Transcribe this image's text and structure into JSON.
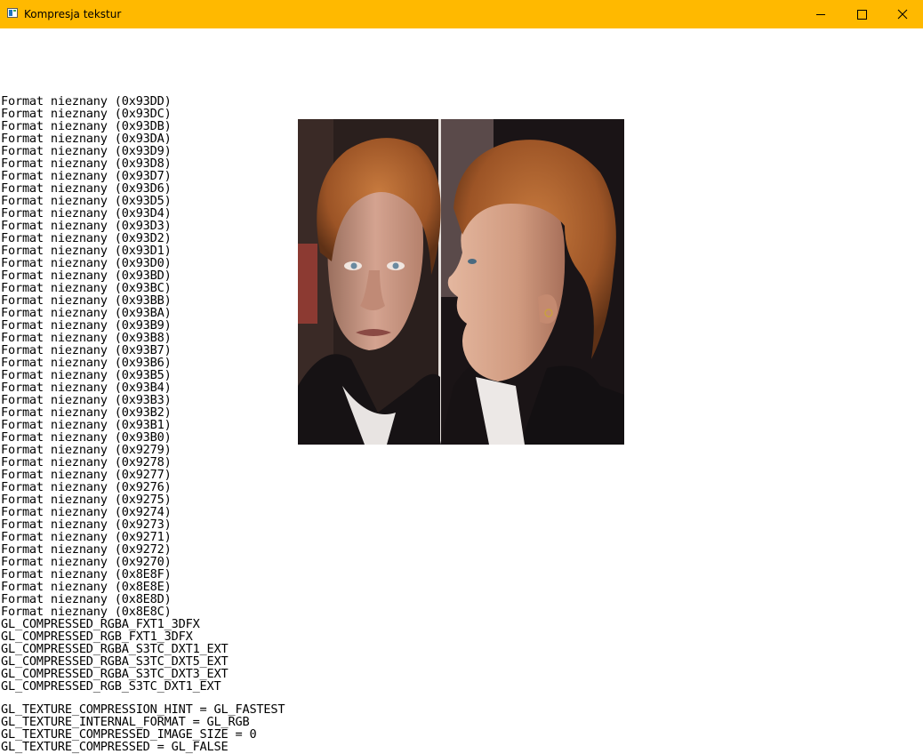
{
  "window": {
    "title": "Kompresja tekstur",
    "accent_color": "#ffb900",
    "icons": [
      "app-icon",
      "minimize-icon",
      "maximize-icon",
      "close-icon"
    ]
  },
  "formats": [
    "Format nieznany (0x93DD)",
    "Format nieznany (0x93DC)",
    "Format nieznany (0x93DB)",
    "Format nieznany (0x93DA)",
    "Format nieznany (0x93D9)",
    "Format nieznany (0x93D8)",
    "Format nieznany (0x93D7)",
    "Format nieznany (0x93D6)",
    "Format nieznany (0x93D5)",
    "Format nieznany (0x93D4)",
    "Format nieznany (0x93D3)",
    "Format nieznany (0x93D2)",
    "Format nieznany (0x93D1)",
    "Format nieznany (0x93D0)",
    "Format nieznany (0x93BD)",
    "Format nieznany (0x93BC)",
    "Format nieznany (0x93BB)",
    "Format nieznany (0x93BA)",
    "Format nieznany (0x93B9)",
    "Format nieznany (0x93B8)",
    "Format nieznany (0x93B7)",
    "Format nieznany (0x93B6)",
    "Format nieznany (0x93B5)",
    "Format nieznany (0x93B4)",
    "Format nieznany (0x93B3)",
    "Format nieznany (0x93B2)",
    "Format nieznany (0x93B1)",
    "Format nieznany (0x93B0)",
    "Format nieznany (0x9279)",
    "Format nieznany (0x9278)",
    "Format nieznany (0x9277)",
    "Format nieznany (0x9276)",
    "Format nieznany (0x9275)",
    "Format nieznany (0x9274)",
    "Format nieznany (0x9273)",
    "Format nieznany (0x9271)",
    "Format nieznany (0x9272)",
    "Format nieznany (0x9270)",
    "Format nieznany (0x8E8F)",
    "Format nieznany (0x8E8E)",
    "Format nieznany (0x8E8D)",
    "Format nieznany (0x8E8C)",
    "GL_COMPRESSED_RGBA_FXT1_3DFX",
    "GL_COMPRESSED_RGB_FXT1_3DFX",
    "GL_COMPRESSED_RGBA_S3TC_DXT1_EXT",
    "GL_COMPRESSED_RGBA_S3TC_DXT5_EXT",
    "GL_COMPRESSED_RGBA_S3TC_DXT3_EXT",
    "GL_COMPRESSED_RGB_S3TC_DXT1_EXT"
  ],
  "params": [
    "GL_TEXTURE_COMPRESSION_HINT = GL_FASTEST",
    "GL_TEXTURE_INTERNAL_FORMAT = GL_RGB",
    "GL_TEXTURE_COMPRESSED_IMAGE_SIZE = 0",
    "GL_TEXTURE_COMPRESSED = GL_FALSE"
  ]
}
